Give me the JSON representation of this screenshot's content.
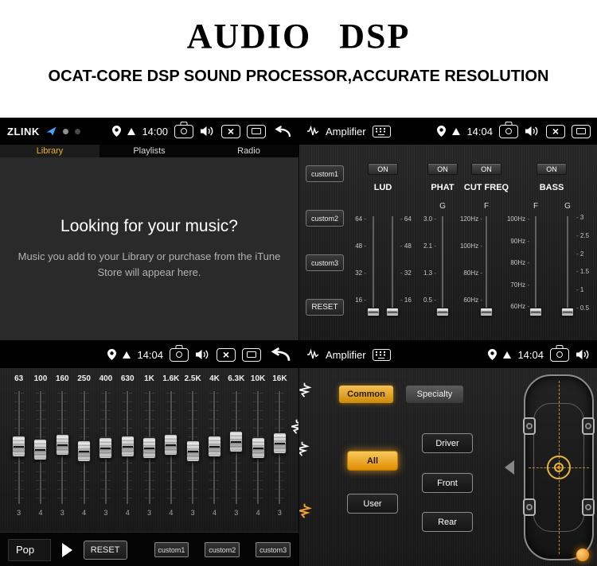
{
  "header": {
    "title": "AUDIO DSP",
    "subtitle": "OCAT-CORE DSP SOUND PROCESSOR,ACCURATE RESOLUTION"
  },
  "colors": {
    "accent_orange": "#F0A32A",
    "zlink_blue": "#45A6FF",
    "panel_bg": "#1E1E1E"
  },
  "library": {
    "brand": "ZLINK",
    "time": "14:00",
    "tabs": {
      "library": "Library",
      "playlists": "Playlists",
      "radio": "Radio"
    },
    "empty_title": "Looking for your music?",
    "empty_body": "Music you add to your Library or purchase from the iTune Store will appear here."
  },
  "amp": {
    "title": "Amplifier",
    "time": "14:04",
    "on_label": "ON",
    "customs": [
      "custom1",
      "custom2",
      "custom3"
    ],
    "reset_label": "RESET",
    "lud": {
      "label": "LUD",
      "ticks": [
        "64",
        "48",
        "32",
        "16"
      ]
    },
    "phat": {
      "label": "PHAT",
      "sub": "G",
      "ticks": [
        "3.0",
        "2.1",
        "1.3",
        "0.5"
      ]
    },
    "cut": {
      "label": "CUT FREQ",
      "sub": "F",
      "ticks": [
        "120Hz",
        "100Hz",
        "80Hz",
        "60Hz"
      ]
    },
    "bass": {
      "label": "BASS",
      "sub_f": "F",
      "sub_g": "G",
      "ticks_f": [
        "100Hz",
        "90Hz",
        "80Hz",
        "70Hz",
        "60Hz"
      ],
      "ticks_g": [
        "3",
        "2.5",
        "2",
        "1.5",
        "1",
        "0.5"
      ]
    }
  },
  "eq": {
    "time": "14:04",
    "preset": "Pop",
    "reset_label": "RESET",
    "customs": [
      "custom1",
      "custom2",
      "custom3"
    ],
    "bands": [
      {
        "freq": "63",
        "value": "3"
      },
      {
        "freq": "100",
        "value": "4"
      },
      {
        "freq": "160",
        "value": "3"
      },
      {
        "freq": "250",
        "value": "4"
      },
      {
        "freq": "400",
        "value": "3"
      },
      {
        "freq": "630",
        "value": "4"
      },
      {
        "freq": "1K",
        "value": "3"
      },
      {
        "freq": "1.6K",
        "value": "4"
      },
      {
        "freq": "2.5K",
        "value": "3"
      },
      {
        "freq": "4K",
        "value": "4"
      },
      {
        "freq": "6.3K",
        "value": "3"
      },
      {
        "freq": "10K",
        "value": "4"
      },
      {
        "freq": "16K",
        "value": "3"
      }
    ]
  },
  "speaker": {
    "title": "Amplifier",
    "time": "14:04",
    "tabs": {
      "common": "Common",
      "specialty": "Specialty"
    },
    "buttons": {
      "all": "All",
      "driver": "Driver",
      "front": "Front",
      "user": "User",
      "rear": "Rear"
    }
  }
}
